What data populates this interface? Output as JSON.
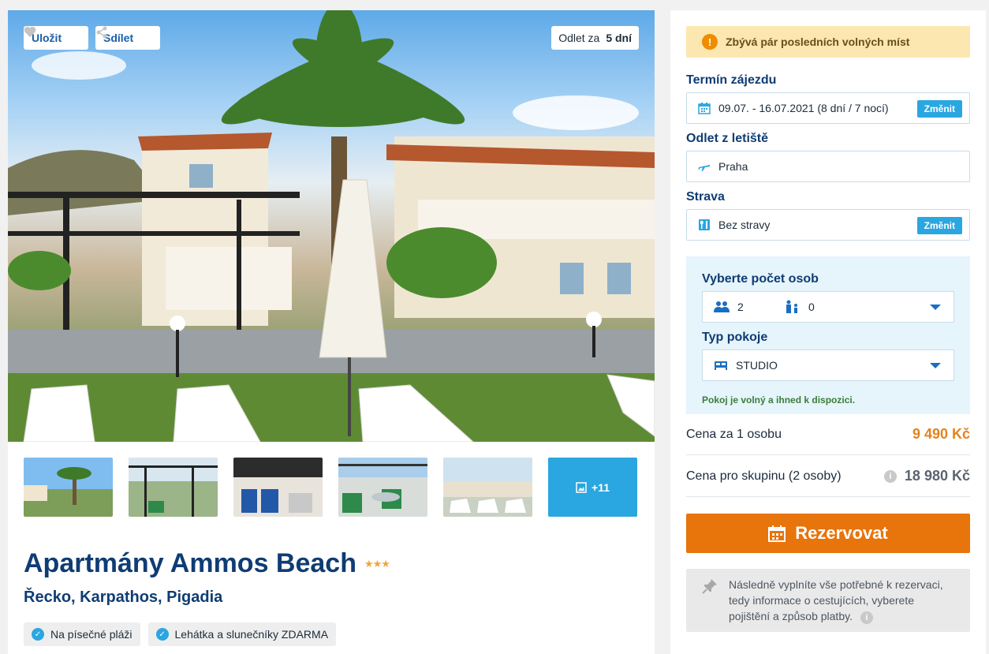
{
  "hero": {
    "save_label": "Uložit",
    "share_label": "Sdílet",
    "depart_prefix": "Odlet za",
    "depart_days": "5 dní"
  },
  "thumbnails": {
    "more_label": "+11"
  },
  "hotel": {
    "name": "Apartmány Ammos Beach",
    "stars": "★★★",
    "location": "Řecko, Karpathos, Pigadia",
    "tags": [
      "Na písečné pláži",
      "Lehátka a slunečníky ZDARMA"
    ]
  },
  "booking": {
    "alert": "Zbývá pár posledních volných míst",
    "term_label": "Termín zájezdu",
    "term_value": "09.07. - 16.07.2021 (8 dní / 7 nocí)",
    "change_label": "Změnit",
    "airport_label": "Odlet z letiště",
    "airport_value": "Praha",
    "board_label": "Strava",
    "board_value": "Bez stravy",
    "persons_label": "Vyberte počet osob",
    "adults": "2",
    "children": "0",
    "room_label": "Typ pokoje",
    "room_value": "STUDIO",
    "availability": "Pokoj je volný a ihned k dispozici.",
    "price_person_label": "Cena za 1 osobu",
    "price_person_value": "9 490 Kč",
    "price_group_label": "Cena pro skupinu (2 osoby)",
    "price_group_value": "18 980 Kč",
    "book_label": "Rezervovat",
    "note": "Následně vyplníte vše potřebné k rezervaci, tedy informace o cestujících, vyberete pojištění a způsob platby."
  },
  "colors": {
    "accent_blue": "#2aa6e0",
    "title_blue": "#0f3c73",
    "book_orange": "#e8740c",
    "alert_bg": "#fce7b0"
  }
}
